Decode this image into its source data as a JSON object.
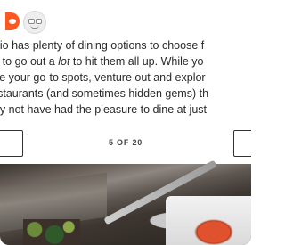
{
  "icons": {
    "reddit": "reddit-icon",
    "emoji": "thinking-face-icon"
  },
  "article": {
    "lines": [
      "onio has plenty of dining options to choose f",
      "ve to go out a ",
      "lot",
      " to hit them all up. While yo",
      "ave your go-to spots, venture out and explor",
      " restaurants (and sometimes hidden gems) th",
      "nay not have had the pleasure to dine at just"
    ]
  },
  "pager": {
    "counter": "5 OF 20"
  }
}
